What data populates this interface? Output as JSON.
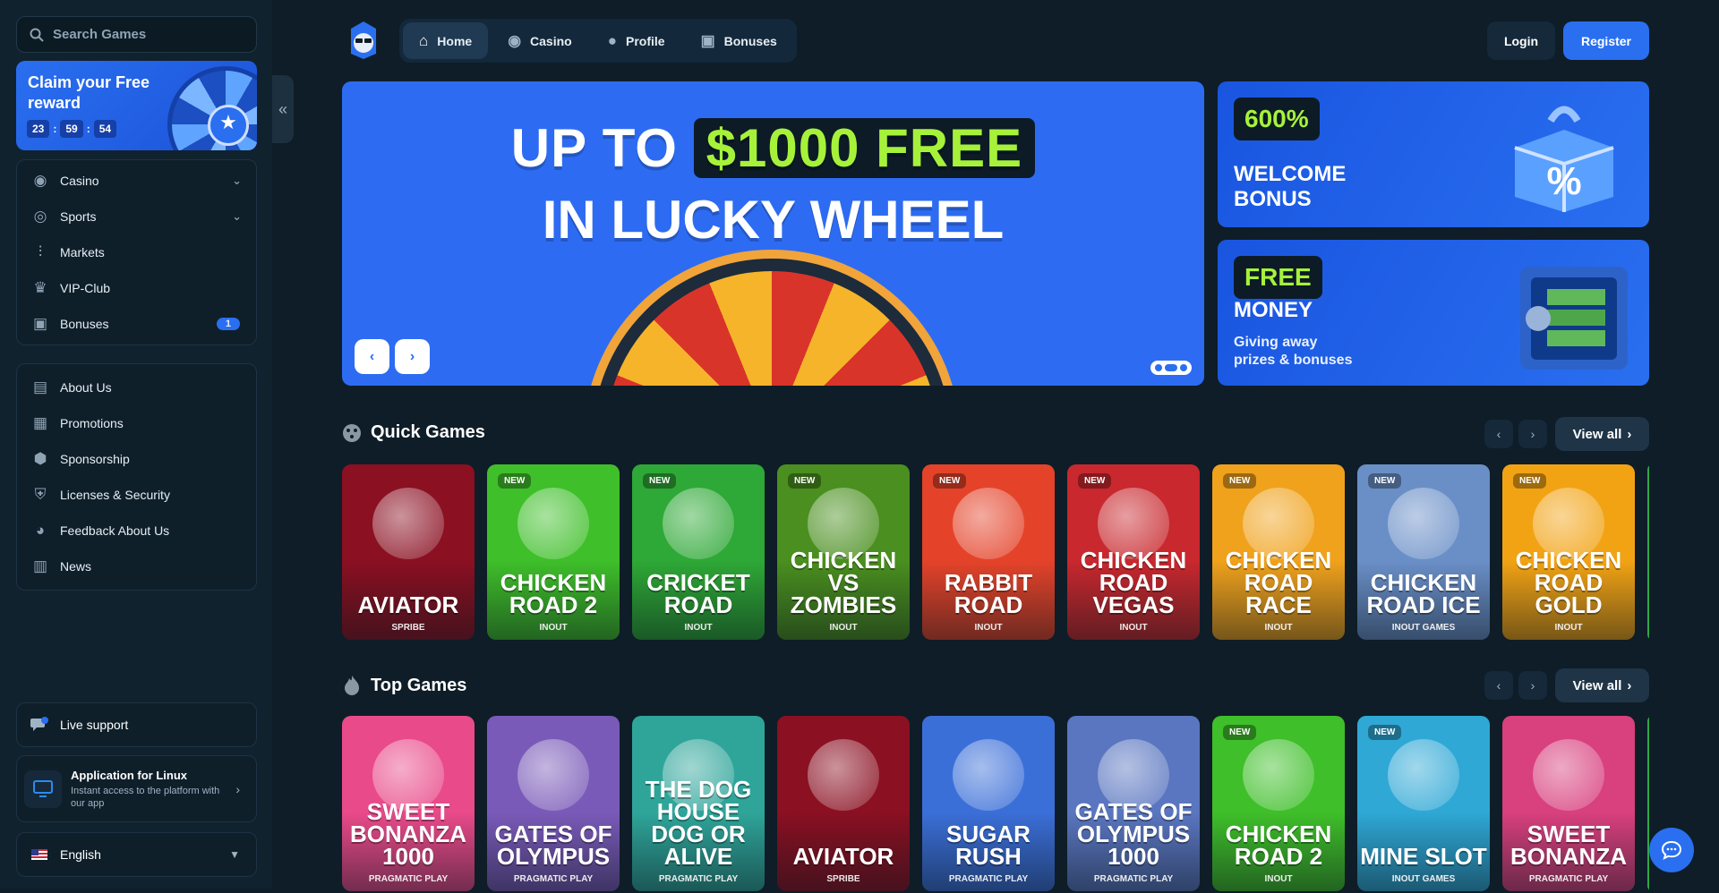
{
  "search": {
    "placeholder": "Search Games"
  },
  "reward": {
    "title": "Claim your Free reward",
    "timer": [
      "23",
      "59",
      "54"
    ]
  },
  "sidebar": {
    "main_items": [
      {
        "label": "Casino",
        "icon": "casino-chip-icon",
        "chevron": true
      },
      {
        "label": "Sports",
        "icon": "globe-icon",
        "chevron": true
      },
      {
        "label": "Markets",
        "icon": "candles-icon"
      },
      {
        "label": "VIP-Club",
        "icon": "crown-icon"
      },
      {
        "label": "Bonuses",
        "icon": "gift-icon",
        "badge": "1"
      }
    ],
    "info_items": [
      {
        "label": "About Us",
        "icon": "book-icon"
      },
      {
        "label": "Promotions",
        "icon": "ticket-icon"
      },
      {
        "label": "Sponsorship",
        "icon": "medal-icon"
      },
      {
        "label": "Licenses & Security",
        "icon": "shield-icon"
      },
      {
        "label": "Feedback About Us",
        "icon": "chat-icon"
      },
      {
        "label": "News",
        "icon": "newspaper-icon"
      }
    ],
    "live_support": "Live support",
    "app": {
      "title": "Application for Linux",
      "subtitle": "Instant access to the platform with our app"
    },
    "language": "English"
  },
  "topnav": {
    "tabs": [
      {
        "label": "Home",
        "icon": "home-icon",
        "active": true
      },
      {
        "label": "Casino",
        "icon": "casino-chip-icon"
      },
      {
        "label": "Profile",
        "icon": "user-icon"
      },
      {
        "label": "Bonuses",
        "icon": "gift-icon"
      }
    ],
    "login": "Login",
    "register": "Register"
  },
  "hero": {
    "line1_prefix": "UP TO",
    "line1_highlight": "$1000 FREE",
    "line2": "IN LUCKY WHEEL"
  },
  "promos": [
    {
      "tag": "600%",
      "title_line1": "WELCOME",
      "title_line2": "BONUS"
    },
    {
      "tag": "FREE",
      "title_line1": "MONEY",
      "subtitle_line1": "Giving away",
      "subtitle_line2": "prizes & bonuses"
    }
  ],
  "quick_games": {
    "title": "Quick Games",
    "view_all": "View all",
    "games": [
      {
        "name": "Aviator",
        "provider": "SPRIBE",
        "new": false,
        "color": "#8a1022"
      },
      {
        "name": "Chicken Road 2",
        "provider": "INOUT",
        "new": true,
        "color": "#3fbf2a"
      },
      {
        "name": "Cricket Road",
        "provider": "INOUT",
        "new": true,
        "color": "#2ea836"
      },
      {
        "name": "Chicken vs Zombies",
        "provider": "INOUT",
        "new": true,
        "color": "#4a8f1f"
      },
      {
        "name": "Rabbit Road",
        "provider": "INOUT",
        "new": true,
        "color": "#e4432a"
      },
      {
        "name": "Chicken Road Vegas",
        "provider": "INOUT",
        "new": true,
        "color": "#c8282e"
      },
      {
        "name": "Chicken Road Race",
        "provider": "INOUT",
        "new": true,
        "color": "#f0a21c"
      },
      {
        "name": "Chicken Road Ice",
        "provider": "INOUT GAMES",
        "new": true,
        "color": "#6a8fc7"
      },
      {
        "name": "Chicken Road Gold",
        "provider": "INOUT",
        "new": true,
        "color": "#f2a314"
      }
    ]
  },
  "top_games": {
    "title": "Top Games",
    "view_all": "View all",
    "games": [
      {
        "name": "Sweet Bonanza 1000",
        "provider": "PRAGMATIC PLAY",
        "new": false,
        "color": "#e94a8a"
      },
      {
        "name": "Gates of Olympus",
        "provider": "PRAGMATIC PLAY",
        "new": false,
        "color": "#7a5ab8"
      },
      {
        "name": "The Dog House Dog or Alive",
        "provider": "PRAGMATIC PLAY",
        "new": false,
        "color": "#2fa59a"
      },
      {
        "name": "Aviator",
        "provider": "SPRIBE",
        "new": false,
        "color": "#8a1022"
      },
      {
        "name": "Sugar Rush",
        "provider": "PRAGMATIC PLAY",
        "new": false,
        "color": "#3b6fd8"
      },
      {
        "name": "Gates of Olympus 1000",
        "provider": "PRAGMATIC PLAY",
        "new": false,
        "color": "#5a76c0"
      },
      {
        "name": "Chicken Road 2",
        "provider": "INOUT",
        "new": true,
        "color": "#3fbf2a"
      },
      {
        "name": "Mine Slot",
        "provider": "INOUT GAMES",
        "new": true,
        "color": "#2fa8d6"
      },
      {
        "name": "Sweet Bonanza",
        "provider": "PRAGMATIC PLAY",
        "new": false,
        "color": "#d8407e"
      }
    ]
  },
  "colors": {
    "accent": "#2a6ff0",
    "highlight": "#a6f23a",
    "background": "#0e1d27"
  }
}
